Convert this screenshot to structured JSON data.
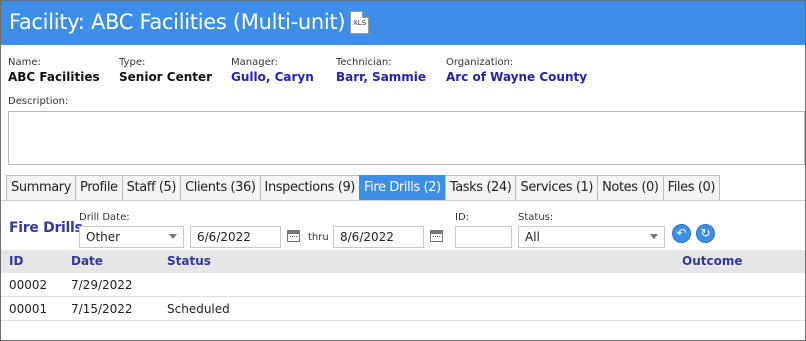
{
  "header": {
    "title": "Facility: ABC Facilities (Multi-unit)",
    "export_icon_text": "XLS"
  },
  "info": {
    "name_label": "Name:",
    "name_value": "ABC Facilities",
    "type_label": "Type:",
    "type_value": "Senior Center",
    "manager_label": "Manager:",
    "manager_value": "Gullo, Caryn",
    "technician_label": "Technician:",
    "technician_value": "Barr, Sammie",
    "organization_label": "Organization:",
    "organization_value": "Arc of Wayne County",
    "description_label": "Description:",
    "description_value": ""
  },
  "tabs": [
    {
      "label": "Summary"
    },
    {
      "label": "Profile"
    },
    {
      "label": "Staff (5)"
    },
    {
      "label": "Clients (36)"
    },
    {
      "label": "Inspections (9)"
    },
    {
      "label": "Fire Drills (2)",
      "active": true
    },
    {
      "label": "Tasks (24)"
    },
    {
      "label": "Services (1)"
    },
    {
      "label": "Notes (0)"
    },
    {
      "label": "Files (0)"
    }
  ],
  "fire_drills": {
    "section_title": "Fire Drills",
    "drill_date_label": "Drill Date:",
    "drill_date_selected": "Other",
    "from_date": "6/6/2022",
    "thru_label": "thru",
    "to_date": "8/6/2022",
    "id_label": "ID:",
    "id_value": "",
    "status_label": "Status:",
    "status_selected": "All",
    "columns": [
      "ID",
      "Date",
      "Status",
      "Outcome"
    ],
    "rows": [
      {
        "id": "00002",
        "date": "7/29/2022",
        "status": "",
        "outcome": ""
      },
      {
        "id": "00001",
        "date": "7/15/2022",
        "status": "Scheduled",
        "outcome": ""
      }
    ]
  },
  "colors": {
    "accent": "#3d8ee6",
    "link": "#2222bb",
    "heading": "#2e3a9e"
  }
}
